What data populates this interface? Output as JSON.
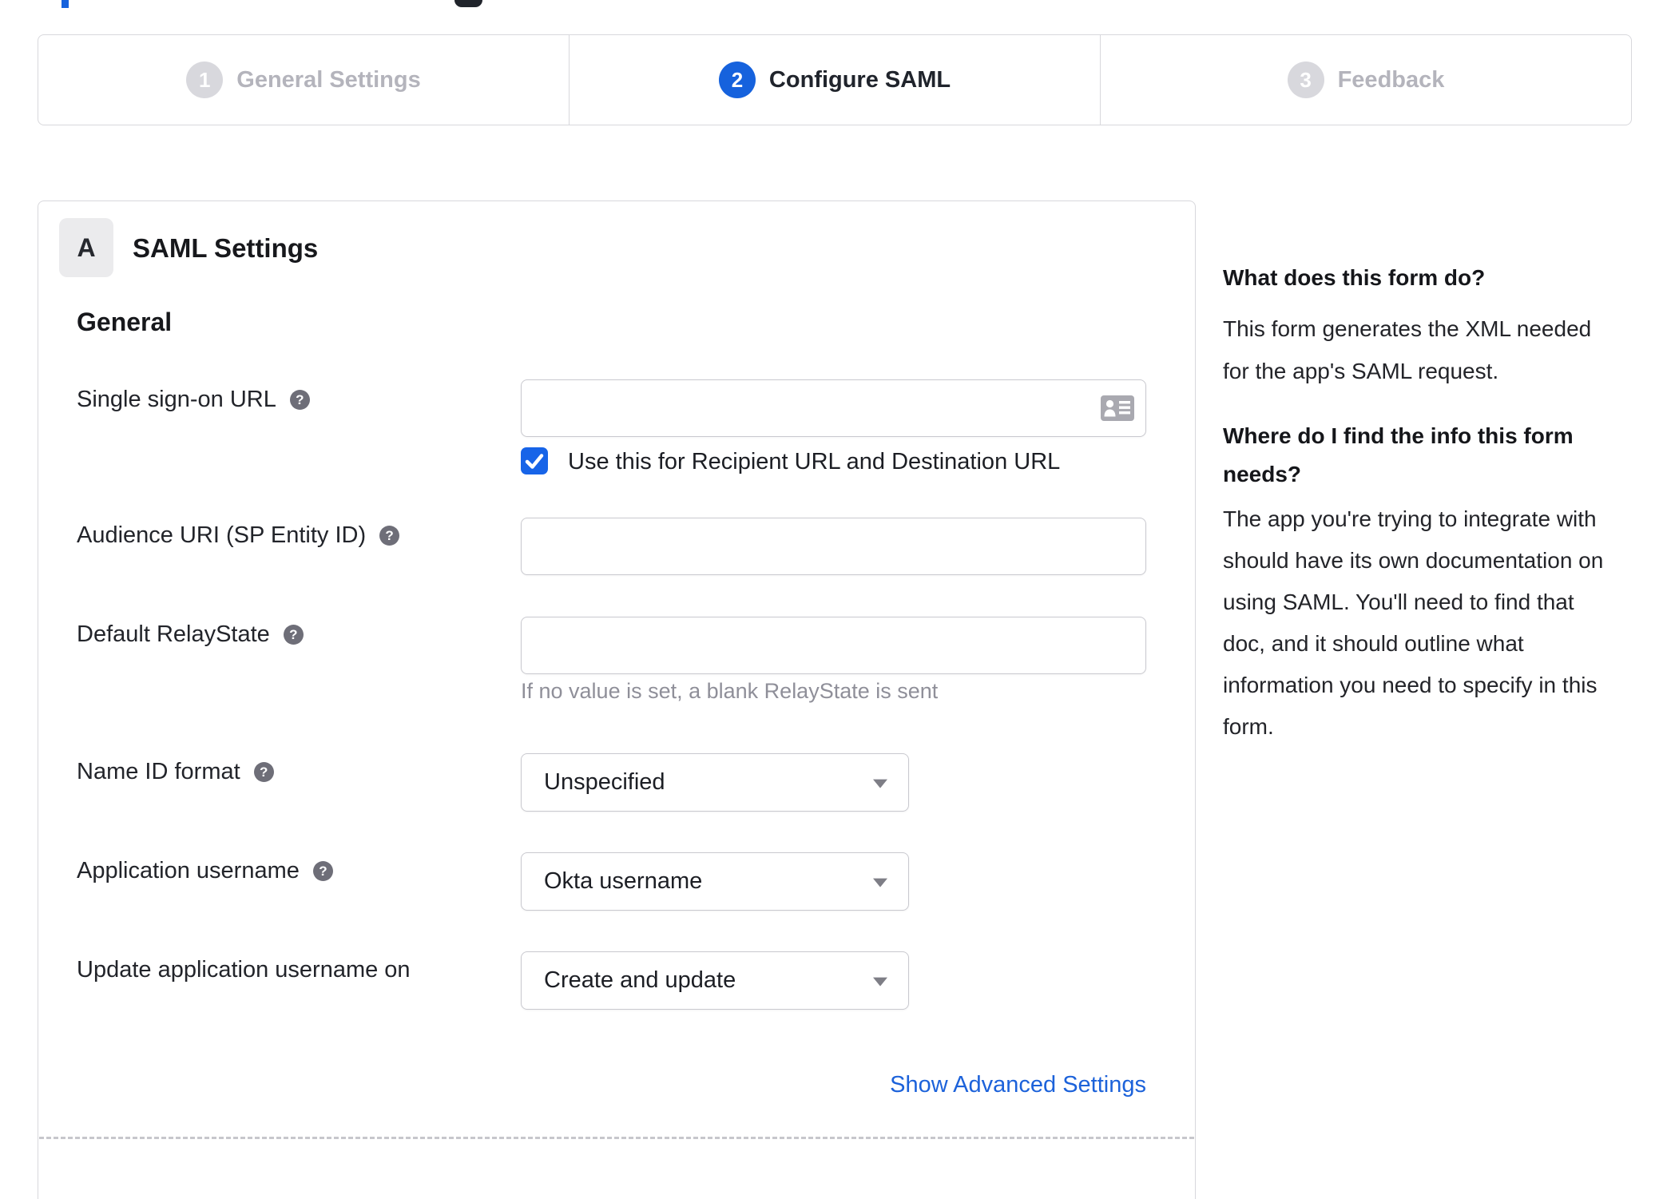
{
  "colors": {
    "accent_blue": "#1662dd",
    "link_blue": "#1c62da",
    "checkbox_blue": "#1764e8",
    "inactive_gray": "#b4b4bc",
    "border_gray": "#d8d8dc",
    "help_icon_gray": "#6e6e78"
  },
  "icons": {
    "help_glyph": "?"
  },
  "stepper": {
    "steps": [
      {
        "number": "1",
        "label": "General Settings",
        "state": "inactive"
      },
      {
        "number": "2",
        "label": "Configure SAML",
        "state": "active"
      },
      {
        "number": "3",
        "label": "Feedback",
        "state": "inactive"
      }
    ]
  },
  "panel": {
    "badge": "A",
    "title": "SAML Settings",
    "section_heading": "General",
    "sso": {
      "label": "Single sign-on URL",
      "value": "",
      "checkbox_checked": true,
      "checkbox_label": "Use this for Recipient URL and Destination URL"
    },
    "audience": {
      "label": "Audience URI (SP Entity ID)",
      "value": ""
    },
    "relay_state": {
      "label": "Default RelayState",
      "value": "",
      "hint": "If no value is set, a blank RelayState is sent"
    },
    "name_id_format": {
      "label": "Name ID format",
      "value": "Unspecified"
    },
    "application_username": {
      "label": "Application username",
      "value": "Okta username"
    },
    "update_application_username": {
      "label": "Update application username on",
      "value": "Create and update"
    },
    "advanced_link": "Show Advanced Settings"
  },
  "sidebar": {
    "q1": {
      "title": "What does this form do?",
      "lines": [
        "This form generates the XML needed",
        "for the app's SAML request."
      ]
    },
    "q2": {
      "title_lines": [
        "Where do I find the info this form",
        "needs?"
      ],
      "lines": [
        "The app you're trying to integrate with",
        "should have its own documentation on",
        "using SAML. You'll need to find that",
        "doc, and it should outline what",
        "information you need to specify in this",
        "form."
      ]
    }
  }
}
